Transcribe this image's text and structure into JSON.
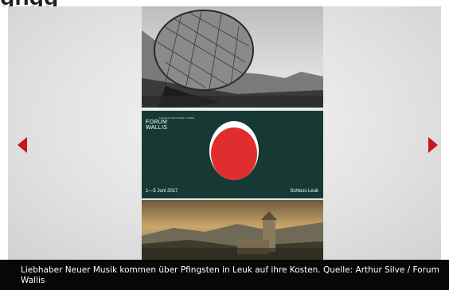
{
  "header": {
    "title_fragment": "gngg"
  },
  "gallery": {
    "prev_icon": "chevron-left-icon",
    "next_icon": "chevron-right-icon",
    "accent_color": "#c4161c",
    "poster": {
      "title_line1": "FORUM",
      "title_line2": "WALLIS",
      "subtitle": "Festival für Neue Musik im Wallis",
      "date": "1—5 Juni 2017",
      "location": "Schloss Leuk"
    }
  },
  "caption": {
    "text": "Liebhaber Neuer Musik kommen über Pfingsten in Leuk auf ihre Kosten. Quelle: Arthur Silve / Forum Wallis"
  }
}
